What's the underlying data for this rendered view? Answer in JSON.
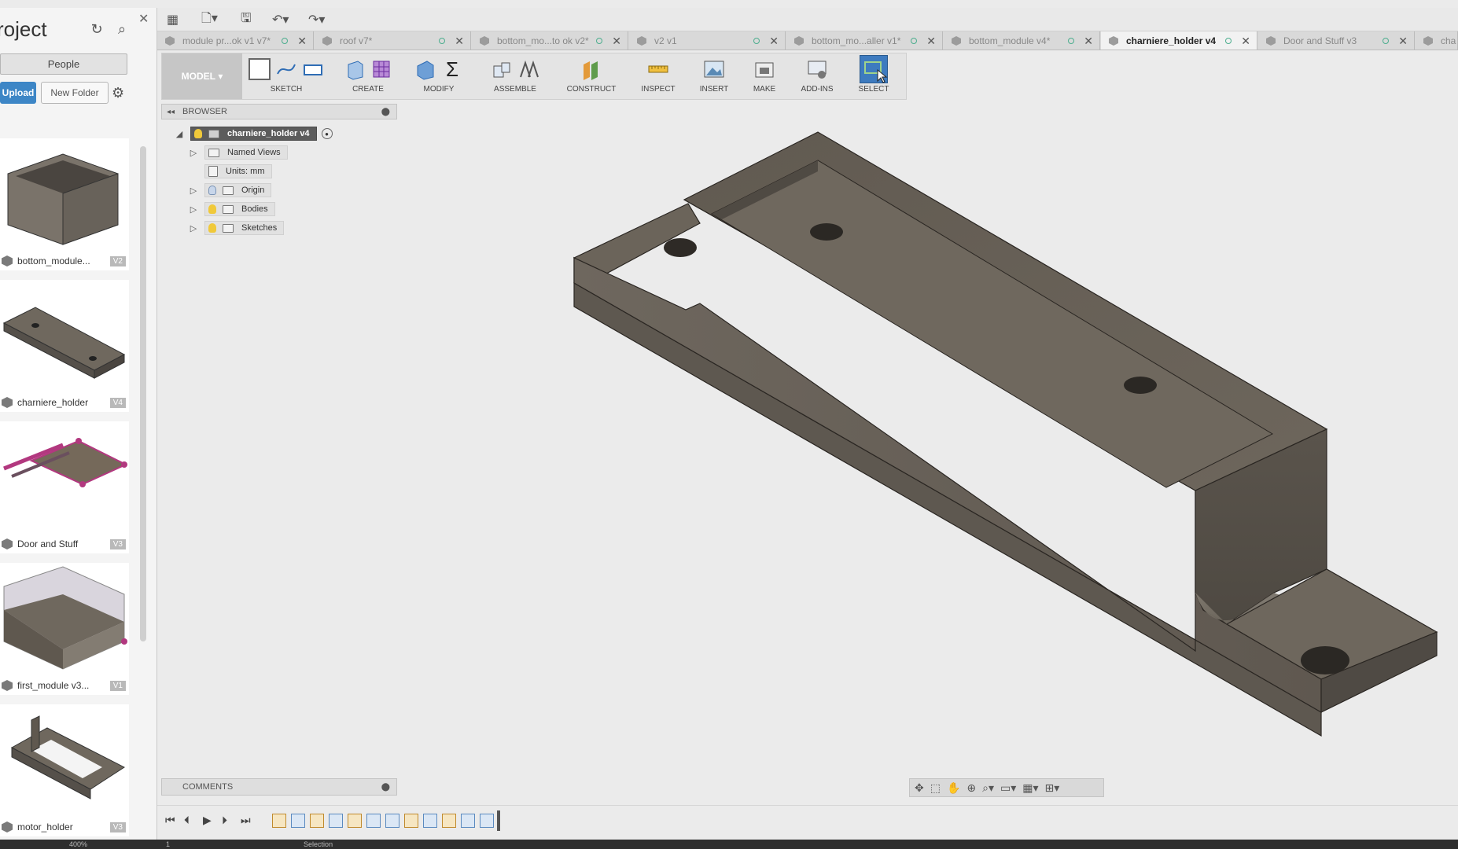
{
  "left_panel": {
    "title": "roject",
    "people_label": "People",
    "upload_label": "Upload",
    "new_folder_label": "New Folder",
    "files": [
      {
        "name": "bottom_module...",
        "version": "V2"
      },
      {
        "name": "charniere_holder",
        "version": "V4"
      },
      {
        "name": "Door and Stuff",
        "version": "V3"
      },
      {
        "name": "first_module v3...",
        "version": "V1"
      },
      {
        "name": "motor_holder",
        "version": "V3"
      }
    ]
  },
  "tabs": [
    {
      "label": "module pr...ok v1 v7*",
      "active": false
    },
    {
      "label": "roof v7*",
      "active": false
    },
    {
      "label": "bottom_mo...to ok v2*",
      "active": false
    },
    {
      "label": "v2 v1",
      "active": false
    },
    {
      "label": "bottom_mo...aller v1*",
      "active": false
    },
    {
      "label": "bottom_module v4*",
      "active": false
    },
    {
      "label": "charniere_holder v4",
      "active": true
    },
    {
      "label": "Door and Stuff v3",
      "active": false
    },
    {
      "label": "cha",
      "active": false
    }
  ],
  "toolbar": {
    "workspace": "MODEL",
    "groups": [
      "SKETCH",
      "CREATE",
      "MODIFY",
      "ASSEMBLE",
      "CONSTRUCT",
      "INSPECT",
      "INSERT",
      "MAKE",
      "ADD-INS",
      "SELECT"
    ]
  },
  "browser": {
    "title": "BROWSER",
    "root": "charniere_holder v4",
    "items": [
      {
        "label": "Named Views"
      },
      {
        "label": "Units: mm"
      },
      {
        "label": "Origin"
      },
      {
        "label": "Bodies"
      },
      {
        "label": "Sketches"
      }
    ]
  },
  "comments": {
    "title": "COMMENTS"
  },
  "status": {
    "zoom": "400%",
    "page": "1",
    "mode": "Selection"
  },
  "colors": {
    "accent": "#3d86c6",
    "model_face": "#6e675c",
    "model_top": "#67605a",
    "background": "#ebebeb"
  }
}
